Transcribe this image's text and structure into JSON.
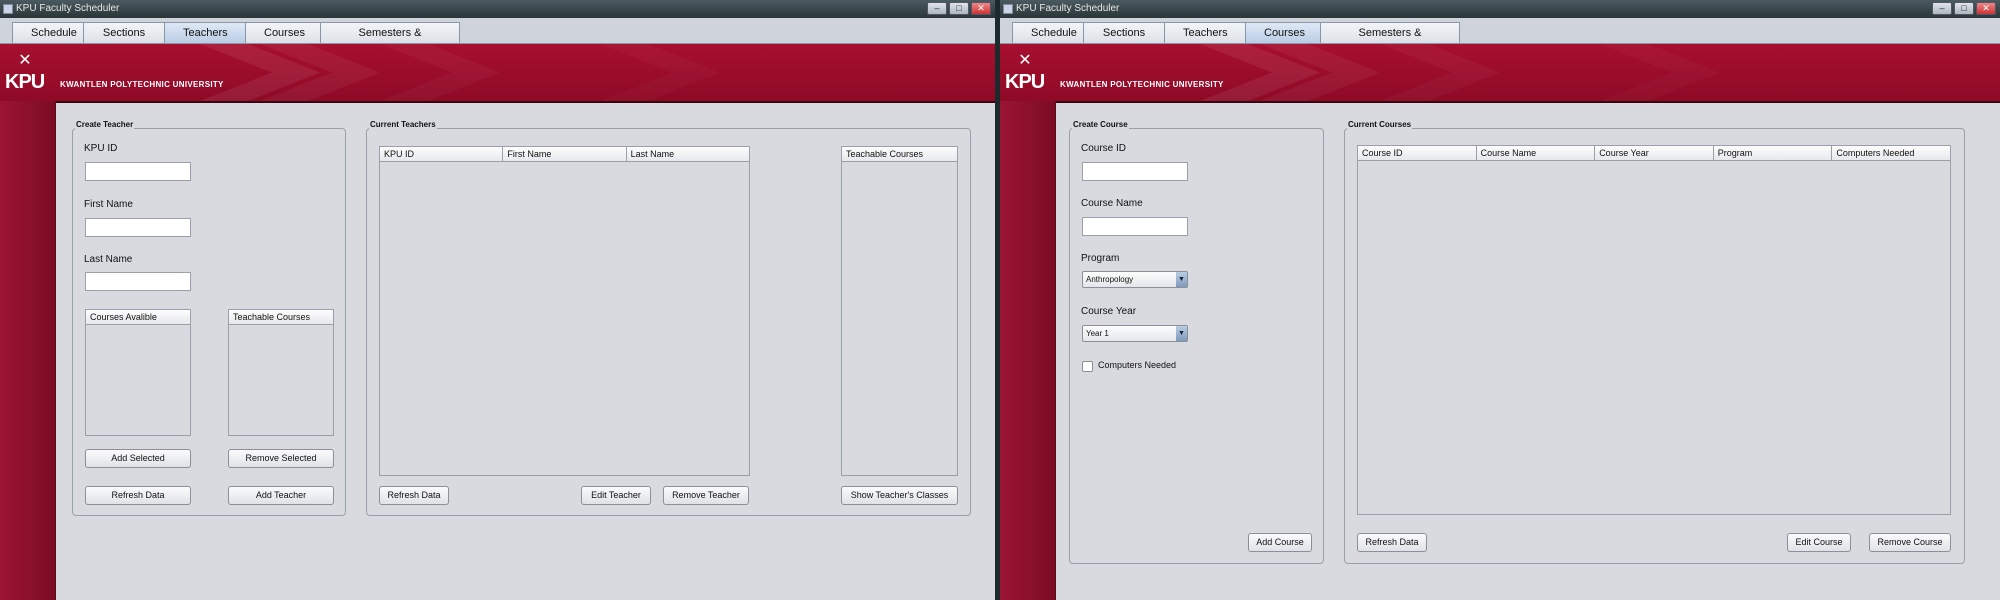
{
  "left": {
    "title": "KPU Faculty Scheduler",
    "tabs": [
      "Schedule",
      "Sections",
      "Teachers",
      "Courses",
      "Semesters & Locations"
    ],
    "active_tab": "Teachers",
    "brand": {
      "logo": "KPU",
      "name": "KWANTLEN POLYTECHNIC UNIVERSITY"
    },
    "create": {
      "title": "Create Teacher",
      "kpu_id_label": "KPU ID",
      "first_name_label": "First Name",
      "last_name_label": "Last Name",
      "courses_available_header": "Courses Avalible",
      "teachable_courses_header": "Teachable Courses",
      "add_selected": "Add Selected",
      "remove_selected": "Remove Selected",
      "refresh_data": "Refresh Data",
      "add_teacher": "Add Teacher"
    },
    "current": {
      "title": "Current Teachers",
      "columns": [
        "KPU ID",
        "First Name",
        "Last Name"
      ],
      "teachable_header": "Teachable Courses",
      "refresh_data": "Refresh Data",
      "edit_teacher": "Edit Teacher",
      "remove_teacher": "Remove Teacher",
      "show_classes": "Show Teacher's Classes"
    }
  },
  "right": {
    "title": "KPU Faculty Scheduler",
    "tabs": [
      "Schedule",
      "Sections",
      "Teachers",
      "Courses",
      "Semesters & Locations"
    ],
    "active_tab": "Courses",
    "brand": {
      "logo": "KPU",
      "name": "KWANTLEN POLYTECHNIC UNIVERSITY"
    },
    "create": {
      "title": "Create Course",
      "course_id_label": "Course ID",
      "course_name_label": "Course Name",
      "program_label": "Program",
      "program_value": "Anthropology",
      "course_year_label": "Course Year",
      "course_year_value": "Year 1",
      "computers_needed_label": "Computers Needed",
      "computers_needed_checked": false,
      "add_course": "Add Course"
    },
    "current": {
      "title": "Current Courses",
      "columns": [
        "Course ID",
        "Course Name",
        "Course Year",
        "Program",
        "Computers Needed"
      ],
      "refresh_data": "Refresh Data",
      "edit_course": "Edit Course",
      "remove_course": "Remove Course"
    }
  }
}
